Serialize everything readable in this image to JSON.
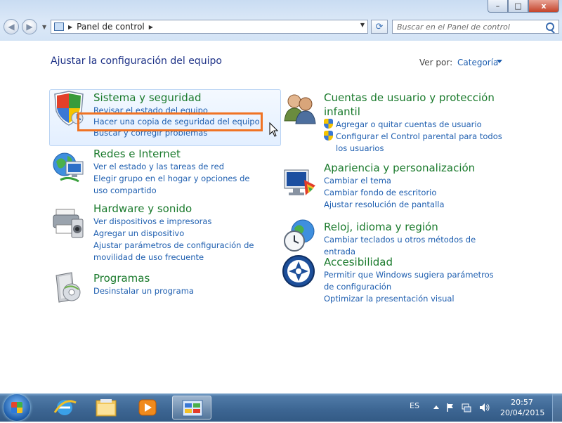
{
  "window": {
    "minimize_label": "–",
    "maximize_label": "□",
    "close_label": "x"
  },
  "nav": {
    "back_icon": "◀",
    "forward_icon": "▶"
  },
  "address": {
    "breadcrumb": "Panel de control",
    "separator": "▶"
  },
  "search": {
    "placeholder": "Buscar en el Panel de control"
  },
  "main": {
    "title": "Ajustar la configuración del equipo",
    "view_by_label": "Ver por:",
    "view_by_value": "Categoría"
  },
  "categories_left": [
    {
      "title": "Sistema y seguridad",
      "links": [
        "Revisar el estado del equipo",
        "Hacer una copia de seguridad del equipo",
        "Buscar y corregir problemas"
      ]
    },
    {
      "title": "Redes e Internet",
      "links": [
        "Ver el estado y las tareas de red",
        "Elegir grupo en el hogar y opciones de uso compartido"
      ]
    },
    {
      "title": "Hardware y sonido",
      "links": [
        "Ver dispositivos e impresoras",
        "Agregar un dispositivo",
        "Ajustar parámetros de configuración de movilidad de uso frecuente"
      ]
    },
    {
      "title": "Programas",
      "links": [
        "Desinstalar un programa"
      ]
    }
  ],
  "categories_right": [
    {
      "title": "Cuentas de usuario y protección infantil",
      "links": [
        "Agregar o quitar cuentas de usuario",
        "Configurar el Control parental para todos los usuarios"
      ]
    },
    {
      "title": "Apariencia y personalización",
      "links": [
        "Cambiar el tema",
        "Cambiar fondo de escritorio",
        "Ajustar resolución de pantalla"
      ]
    },
    {
      "title": "Reloj, idioma y región",
      "links": [
        "Cambiar teclados u otros métodos de entrada"
      ]
    },
    {
      "title": "Accesibilidad",
      "links": [
        "Permitir que Windows sugiera parámetros de configuración",
        "Optimizar la presentación visual"
      ]
    }
  ],
  "taskbar": {
    "language": "ES",
    "time": "20:57",
    "date": "20/04/2015"
  },
  "colors": {
    "link": "#1f5fb0",
    "category_title": "#1a7a2c",
    "highlight": "#f07324"
  }
}
